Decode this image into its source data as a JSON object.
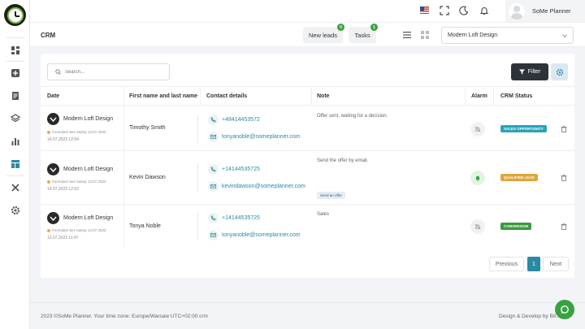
{
  "app": {
    "title": "SoMe Planner"
  },
  "header": {
    "user_name": "SoMe Planner",
    "page_title": "CRM",
    "new_leads_label": "New leads",
    "new_leads_count": "0",
    "tasks_label": "Tasks",
    "tasks_count": "1",
    "workspace_selected": "Modern Loft Design"
  },
  "toolbar": {
    "search_placeholder": "Search...",
    "filter_label": "Filter"
  },
  "table": {
    "columns": [
      "Date",
      "First name and last name",
      "Contact details",
      "Note",
      "Alarm",
      "CRM Status"
    ],
    "rows": [
      {
        "company": "Modern Loft Design",
        "form": "Formularz bez nazwy 13.07.2023",
        "date": "14.07.2023 12:54",
        "name": "Timothy Smith",
        "phone": "+48414453572",
        "email": "tonyanoble@someplanner.com",
        "note": "Offer sent, waiting for a decision.",
        "note_tag": "",
        "alarm": false,
        "status": "SALES OPPORTUNITY",
        "status_color": "#2aa3b8"
      },
      {
        "company": "Modern Loft Design",
        "form": "Formularz bez nazwy 13.07.2023",
        "date": "14.07.2023 12:53",
        "name": "Kevin Dawson",
        "phone": "+14144535725",
        "email": "kevindawson@someplanner.com",
        "note": "Send the offer by email.",
        "note_tag": "Send an offer",
        "alarm": true,
        "status": "QUALIFIED LEAD",
        "status_color": "#e0a43a"
      },
      {
        "company": "Modern Loft Design",
        "form": "Formularz bez nazwy 13.07.2023",
        "date": "13.07.2023 11:47",
        "name": "Tonya Noble",
        "phone": "+14144535725",
        "email": "tonyanoble@someplanner.com",
        "note": "Sales",
        "note_tag": "",
        "alarm": false,
        "status": "CONVERSION",
        "status_color": "#3a9a3f"
      }
    ]
  },
  "pagination": {
    "previous": "Previous",
    "current": "1",
    "next": "Next"
  },
  "footer": {
    "left": "2023 ©SoMe Planner. Your time zone: Europe/Warsaw UTC+02:00 crm",
    "right": "Design & Develop by Bit..."
  },
  "colors": {
    "accent": "#2a8aa3",
    "brand_green": "#38a23f",
    "dark": "#2e333a"
  }
}
